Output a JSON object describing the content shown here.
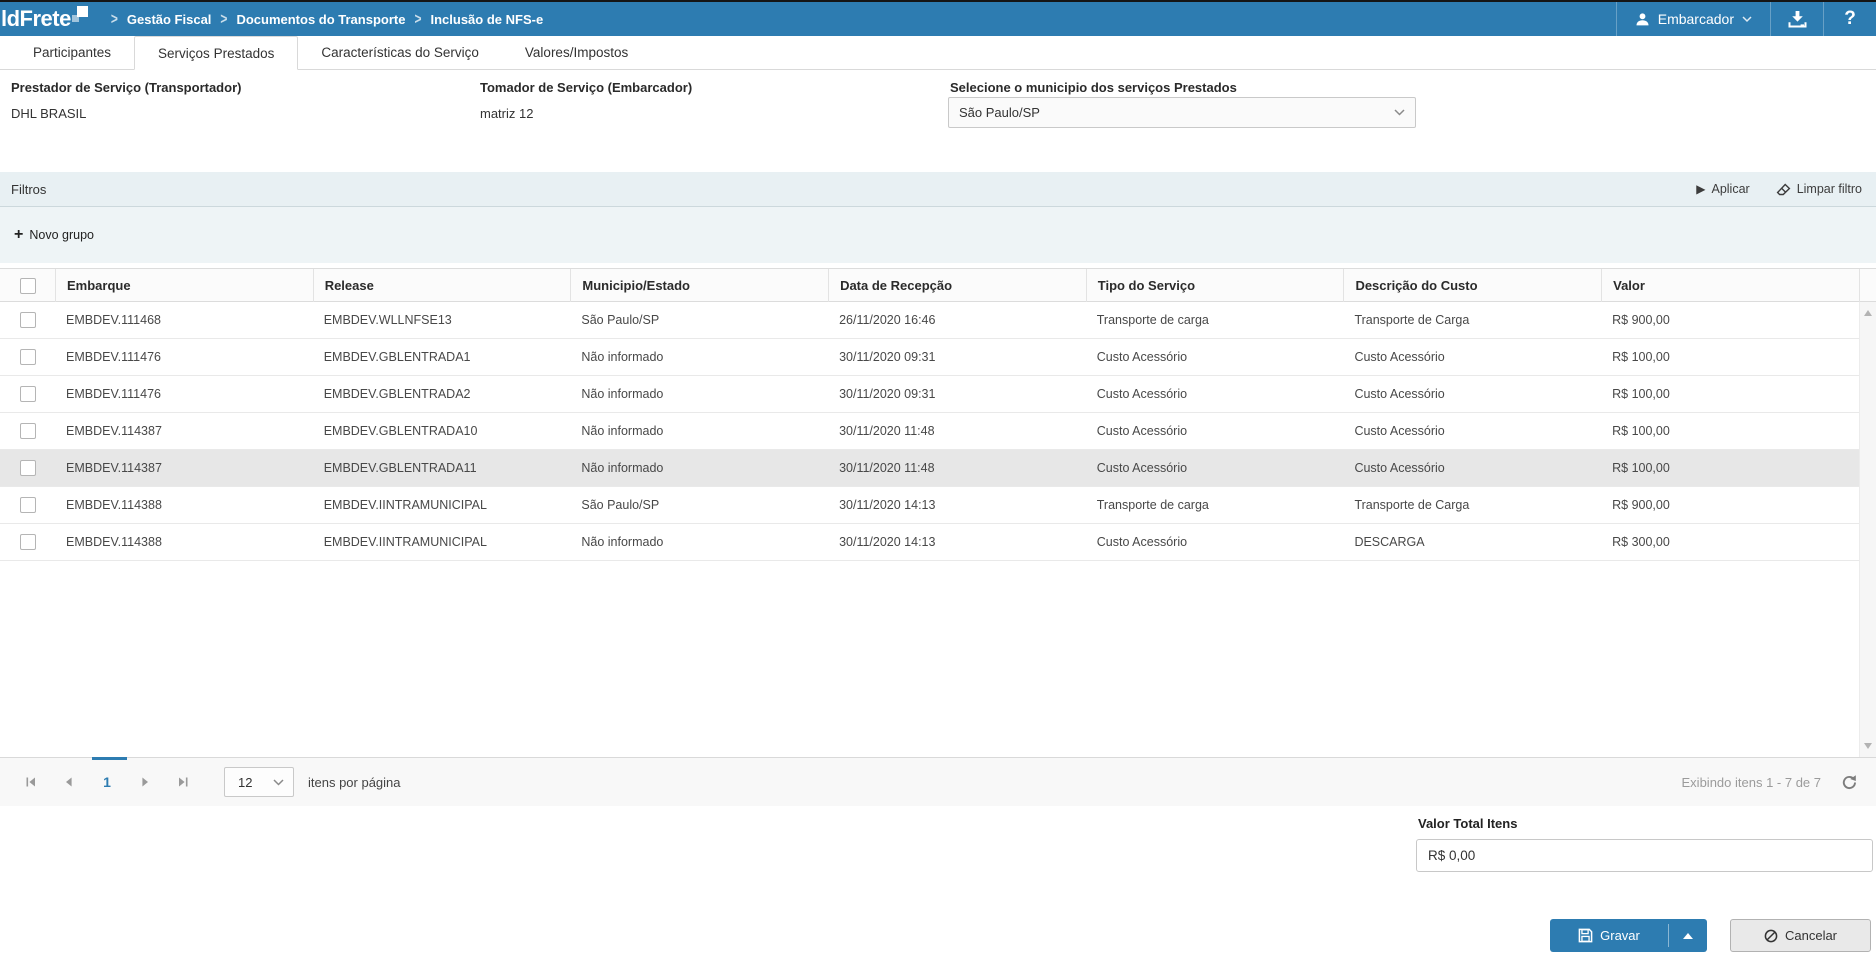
{
  "colors": {
    "brand_blue": "#2d7cb1",
    "filter_bar_bg": "#e8f0f3",
    "row_highlight": "#e7e7e7"
  },
  "topbar": {
    "logo_text": "ldFrete",
    "breadcrumbs": [
      "Gestão Fiscal",
      "Documentos do Transporte",
      "Inclusão de NFS-e"
    ],
    "user_label": "Embarcador",
    "help_label": "?"
  },
  "tabs": {
    "items": [
      "Participantes",
      "Serviços Prestados",
      "Características do Serviço",
      "Valores/Impostos"
    ],
    "active": "Serviços Prestados"
  },
  "form": {
    "prestador_label": "Prestador de Serviço (Transportador)",
    "prestador_value": "DHL BRASIL",
    "tomador_label": "Tomador de Serviço (Embarcador)",
    "tomador_value": "matriz 12",
    "municipio_label": "Selecione o municipio dos serviços Prestados",
    "municipio_value": "São Paulo/SP"
  },
  "filters": {
    "title": "Filtros",
    "apply_label": "Aplicar",
    "clear_label": "Limpar filtro",
    "new_group_label": "Novo grupo"
  },
  "table": {
    "columns": [
      "Embarque",
      "Release",
      "Municipio/Estado",
      "Data de Recepção",
      "Tipo do Serviço",
      "Descrição do Custo",
      "Valor"
    ],
    "rows": [
      [
        "EMBDEV.111468",
        "EMBDEV.WLLNFSE13",
        "São Paulo/SP",
        "26/11/2020 16:46",
        "Transporte de carga",
        "Transporte de Carga",
        "R$ 900,00"
      ],
      [
        "EMBDEV.111476",
        "EMBDEV.GBLENTRADA1",
        "Não informado",
        "30/11/2020 09:31",
        "Custo Acessório",
        "Custo Acessório",
        "R$ 100,00"
      ],
      [
        "EMBDEV.111476",
        "EMBDEV.GBLENTRADA2",
        "Não informado",
        "30/11/2020 09:31",
        "Custo Acessório",
        "Custo Acessório",
        "R$ 100,00"
      ],
      [
        "EMBDEV.114387",
        "EMBDEV.GBLENTRADA10",
        "Não informado",
        "30/11/2020 11:48",
        "Custo Acessório",
        "Custo Acessório",
        "R$ 100,00"
      ],
      [
        "EMBDEV.114387",
        "EMBDEV.GBLENTRADA11",
        "Não informado",
        "30/11/2020 11:48",
        "Custo Acessório",
        "Custo Acessório",
        "R$ 100,00"
      ],
      [
        "EMBDEV.114388",
        "EMBDEV.IINTRAMUNICIPAL",
        "São Paulo/SP",
        "30/11/2020 14:13",
        "Transporte de carga",
        "Transporte de Carga",
        "R$ 900,00"
      ],
      [
        "EMBDEV.114388",
        "EMBDEV.IINTRAMUNICIPAL",
        "Não informado",
        "30/11/2020 14:13",
        "Custo Acessório",
        "DESCARGA",
        "R$ 300,00"
      ]
    ],
    "highlighted_row_index": 4
  },
  "pagination": {
    "page": "1",
    "page_size": "12",
    "per_page_label": "itens por página",
    "summary": "Exibindo itens 1 - 7 de 7"
  },
  "totals": {
    "label": "Valor Total Itens",
    "value": "R$ 0,00"
  },
  "actions": {
    "save": "Gravar",
    "cancel": "Cancelar"
  }
}
